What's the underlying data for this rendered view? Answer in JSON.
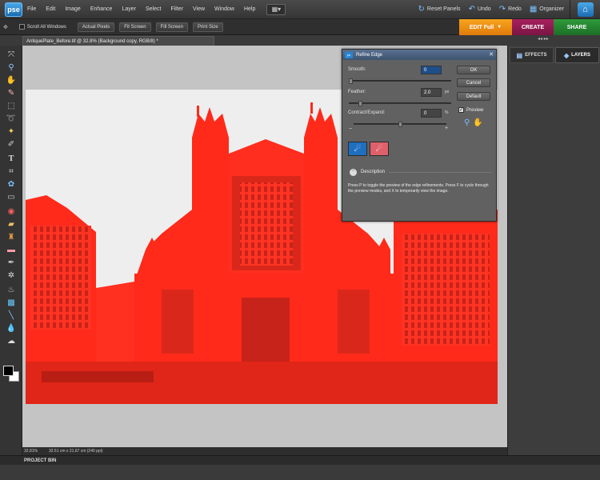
{
  "app": {
    "logo": "pse"
  },
  "menu": [
    "File",
    "Edit",
    "Image",
    "Enhance",
    "Layer",
    "Select",
    "Filter",
    "View",
    "Window",
    "Help"
  ],
  "top_actions": {
    "layout_icon": "layout-grid-icon",
    "reset_panels": "Reset Panels",
    "undo": "Undo",
    "redo": "Redo",
    "organizer": "Organizer",
    "home_icon": "home-icon"
  },
  "options_bar": {
    "scroll_all_windows": "Scroll All Windows",
    "actual_pixels": "Actual Pixels",
    "fit_screen": "Fit Screen",
    "fill_screen": "Fill Screen",
    "print_size": "Print Size"
  },
  "mode_tabs": {
    "edit": "EDIT Full",
    "create": "CREATE",
    "share": "SHARE"
  },
  "document": {
    "tab_title": "AntiquePlate_Before.tif @ 32.8% (Background copy, RGB/8) *"
  },
  "status": {
    "zoom": "32.81%",
    "doc_size": "32.51 cm x 21.67 cm (240 ppi)"
  },
  "project_bin": "PROJECT BIN",
  "panels": {
    "effects": "EFFECTS",
    "layers": "LAYERS"
  },
  "colors": {
    "overlay_red": "#ff2a1a",
    "edit_tab": "#f08a14",
    "create_tab": "#8c1a50",
    "share_tab": "#25822f"
  },
  "dialog": {
    "title": "Refine Edge",
    "smooth_label": "Smooth:",
    "smooth_value": "0",
    "feather_label": "Feather:",
    "feather_value": "2.0",
    "feather_unit": "px",
    "contract_label": "Contract/Expand:",
    "contract_value": "0",
    "contract_unit": "%",
    "minus": "−",
    "plus": "+",
    "ok": "OK",
    "cancel": "Cancel",
    "default": "Default",
    "preview_label": "Preview",
    "preview_checked": true,
    "description_label": "Description",
    "description_text": "Press P to toggle the preview of the edge refinements. Press F to cycle through the preview modes, and X to temporarily view the image.",
    "smooth_level": 0,
    "feather_level": 0.1,
    "contract_level": 0.5
  },
  "tools": [
    "move-tool-icon",
    "zoom-tool-icon",
    "hand-tool-icon",
    "eyedropper-tool-icon",
    "marquee-tool-icon",
    "lasso-tool-icon",
    "magic-wand-tool-icon",
    "quick-selection-tool-icon",
    "type-tool-icon",
    "crop-tool-icon",
    "cookie-cutter-tool-icon",
    "straighten-tool-icon",
    "red-eye-tool-icon",
    "spot-healing-tool-icon",
    "clone-stamp-tool-icon",
    "eraser-tool-icon",
    "brush-tool-icon",
    "smart-brush-tool-icon",
    "paint-bucket-tool-icon",
    "gradient-tool-icon",
    "line-tool-icon",
    "blur-tool-icon",
    "sponge-tool-icon"
  ]
}
